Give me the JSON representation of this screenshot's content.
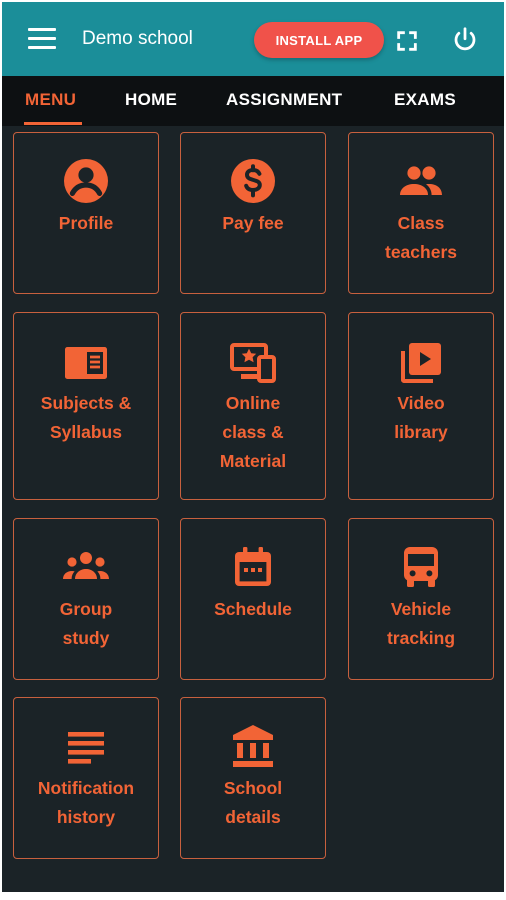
{
  "appbar": {
    "title": "Demo school",
    "install_label": "INSTALL APP",
    "menu_icon": "hamburger-menu-icon",
    "fullscreen_icon": "fullscreen-icon",
    "power_icon": "power-icon",
    "background_color": "#1b8e99",
    "install_color": "#f0524a"
  },
  "tabs": [
    {
      "label": "MENU",
      "active": true
    },
    {
      "label": "HOME",
      "active": false
    },
    {
      "label": "ASSIGNMENT",
      "active": false
    },
    {
      "label": "EXAMS",
      "active": false
    }
  ],
  "theme": {
    "accent": "#f26436",
    "background": "#1b2327"
  },
  "tiles": [
    {
      "label": "Profile",
      "icon": "account-circle-icon"
    },
    {
      "label": "Pay fee",
      "icon": "dollar-coin-icon"
    },
    {
      "label": "Class\nteachers",
      "icon": "people-icon"
    },
    {
      "label": "Subjects &\nSyllabus",
      "icon": "book-icon"
    },
    {
      "label": "Online\nclass &\nMaterial",
      "icon": "devices-star-icon"
    },
    {
      "label": "Video\nlibrary",
      "icon": "video-library-icon"
    },
    {
      "label": "Group\nstudy",
      "icon": "group-icon"
    },
    {
      "label": "Schedule",
      "icon": "calendar-icon"
    },
    {
      "label": "Vehicle\ntracking",
      "icon": "bus-icon"
    },
    {
      "label": "Notification\nhistory",
      "icon": "notes-icon"
    },
    {
      "label": "School\ndetails",
      "icon": "bank-building-icon"
    }
  ]
}
